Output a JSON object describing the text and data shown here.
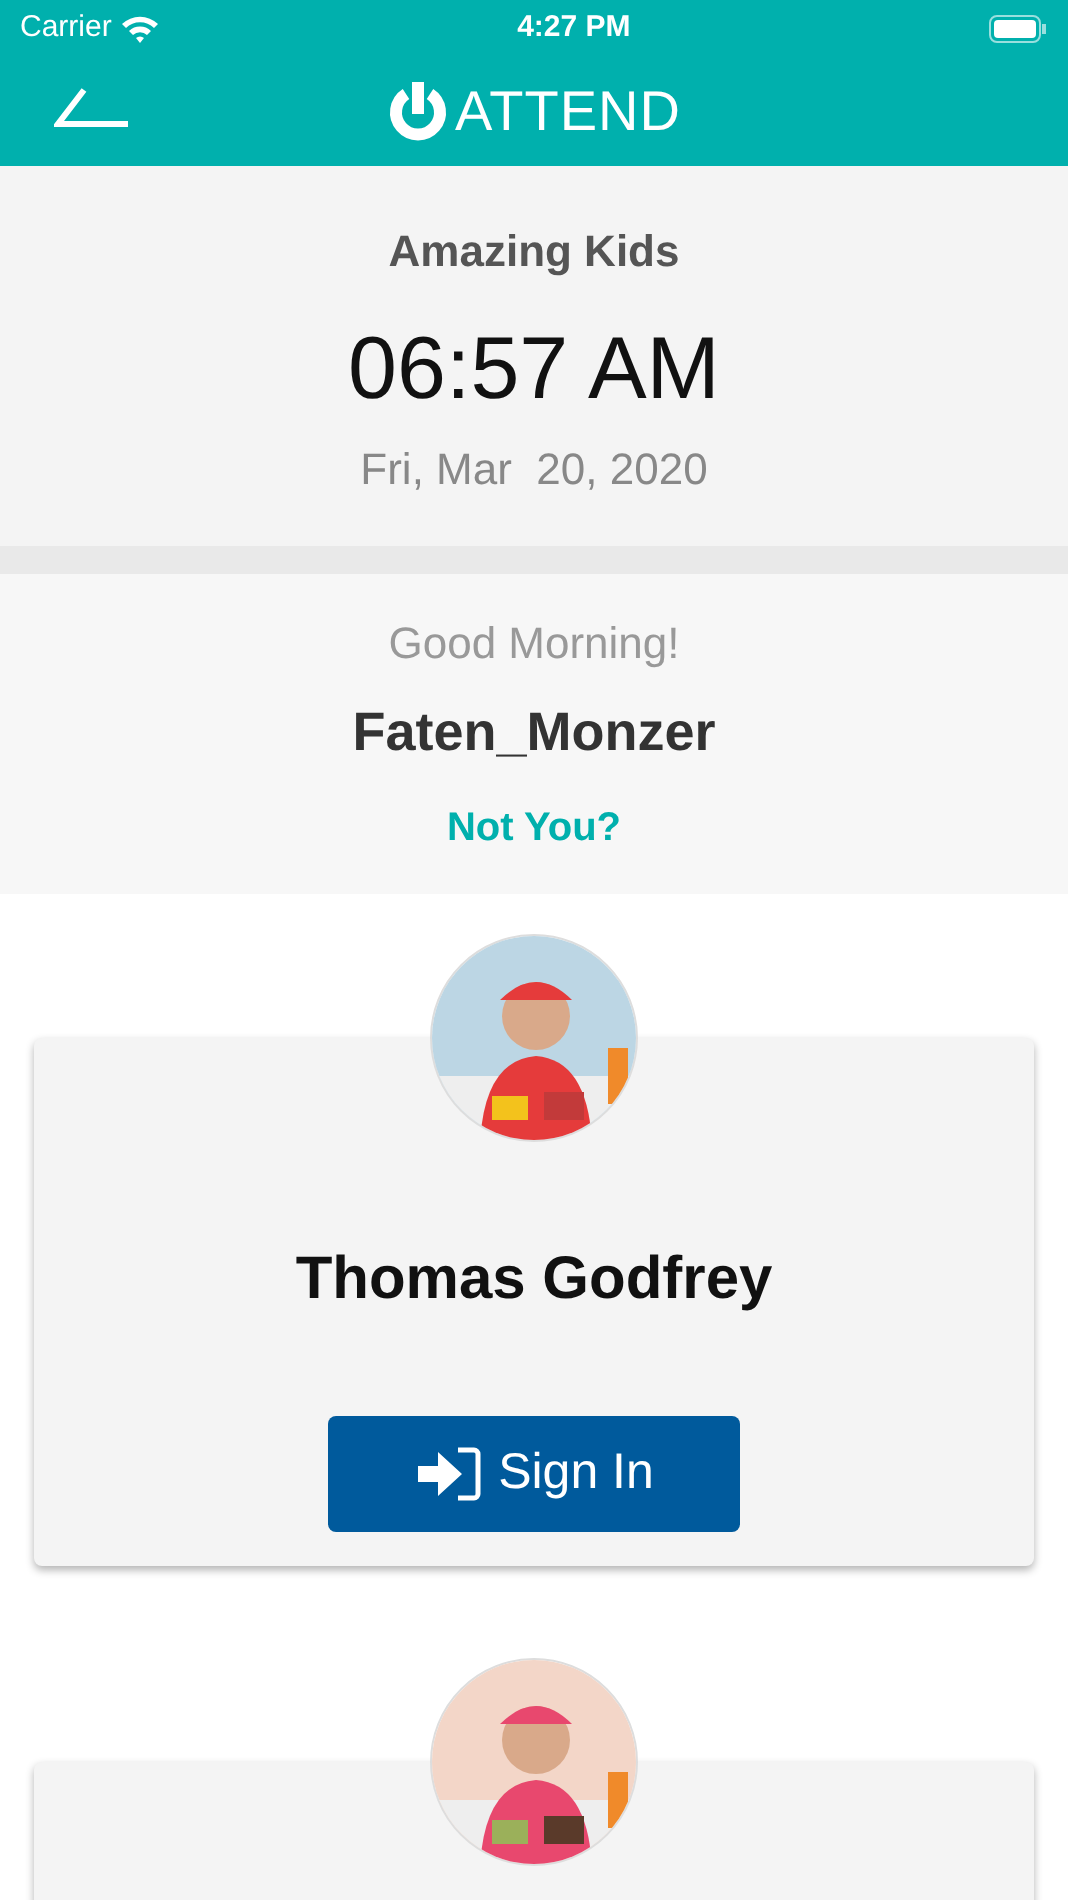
{
  "status_bar": {
    "carrier": "Carrier",
    "time": "4:27 PM"
  },
  "nav": {
    "title": "ATTEND"
  },
  "header": {
    "group": "Amazing Kids",
    "time": "06:57 AM",
    "date": "Fri, Mar  20, 2020"
  },
  "greeting": {
    "salutation": "Good Morning!",
    "user": "Faten_Monzer",
    "link": "Not You?"
  },
  "children": [
    {
      "photo": {
        "kind": "picture"
      },
      "name": "Thomas Godfrey",
      "action": "Sign In"
    },
    {
      "photo": {
        "kind": "picture"
      }
    }
  ]
}
